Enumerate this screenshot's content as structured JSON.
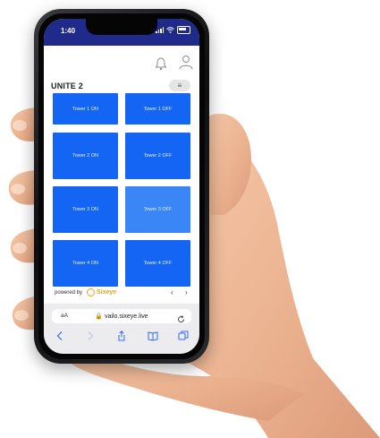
{
  "status": {
    "time": "1:40"
  },
  "header": {
    "title": "UNITE 2",
    "menu_glyph": "≡",
    "bell_icon": "bell-icon",
    "user_icon": "user-icon"
  },
  "tiles": [
    {
      "label": "Tower 1 ON",
      "state": "on"
    },
    {
      "label": "Tower 1 OFF",
      "state": "off"
    },
    {
      "label": "Tower 2 ON",
      "state": "on"
    },
    {
      "label": "Tower 2 OFF",
      "state": "off"
    },
    {
      "label": "Tower 3 ON",
      "state": "on"
    },
    {
      "label": "Tower 3 OFF",
      "state": "off-dim"
    },
    {
      "label": "Tower 4 ON",
      "state": "on"
    },
    {
      "label": "Tower 4 OFF",
      "state": "off"
    }
  ],
  "footer": {
    "powered_by": "powered by",
    "brand": "Sixeye",
    "prev": "‹",
    "next": "›"
  },
  "browser": {
    "text_size": "aA",
    "url": "🔒 vailo.sixeye.live"
  },
  "colors": {
    "tile": "#1565f5",
    "tile_dim": "#3a86f7",
    "statusbar": "#1f2a8a",
    "brand": "#f0a020"
  }
}
